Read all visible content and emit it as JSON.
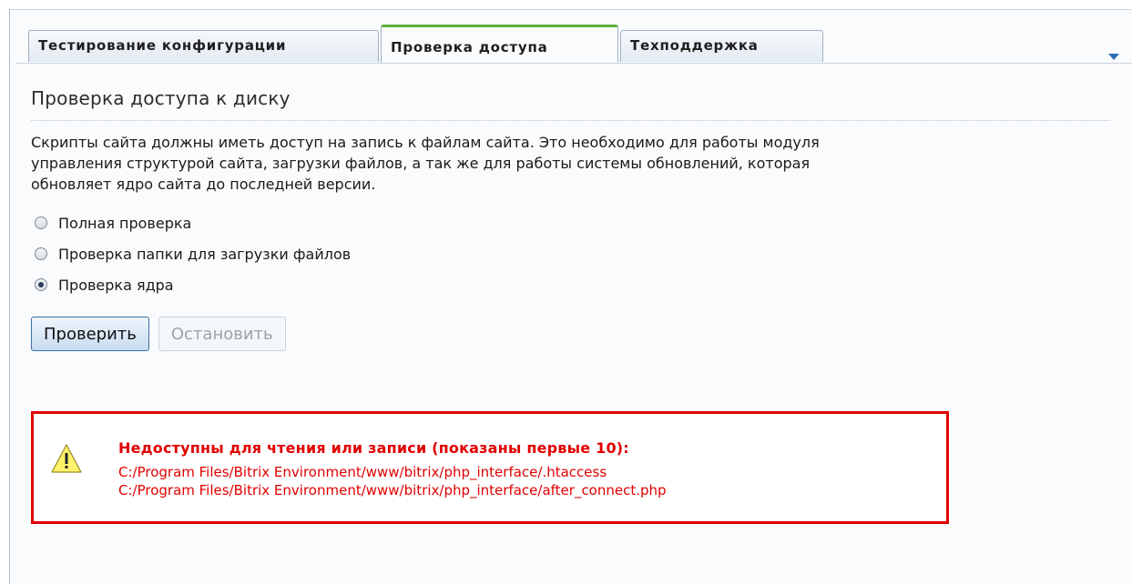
{
  "tabs": [
    {
      "label": "Тестирование конфигурации",
      "active": false
    },
    {
      "label": "Проверка доступа",
      "active": true
    },
    {
      "label": "Техподдержка",
      "active": false
    }
  ],
  "section": {
    "title": "Проверка доступа к диску",
    "description_lines": [
      "Скрипты сайта должны иметь доступ на запись к файлам сайта. Это необходимо для работы модуля",
      "управления структурой сайта, загрузки файлов, а так же для работы системы обновлений, которая",
      "обновляет ядро сайта до последней версии."
    ]
  },
  "options": [
    {
      "label": "Полная проверка",
      "checked": false
    },
    {
      "label": "Проверка папки для загрузки файлов",
      "checked": false
    },
    {
      "label": "Проверка ядра",
      "checked": true
    }
  ],
  "buttons": {
    "check": "Проверить",
    "stop": "Остановить"
  },
  "error": {
    "title": "Недоступны для чтения или записи (показаны первые 10):",
    "paths": [
      "C:/Program Files/Bitrix Environment/www/bitrix/php_interface/.htaccess",
      "C:/Program Files/Bitrix Environment/www/bitrix/php_interface/after_connect.php"
    ],
    "icon": "warning-icon",
    "color": "#e00000"
  },
  "colors": {
    "active_tab_accent": "#5fb336",
    "primary_button_border": "#3f6fa6"
  }
}
